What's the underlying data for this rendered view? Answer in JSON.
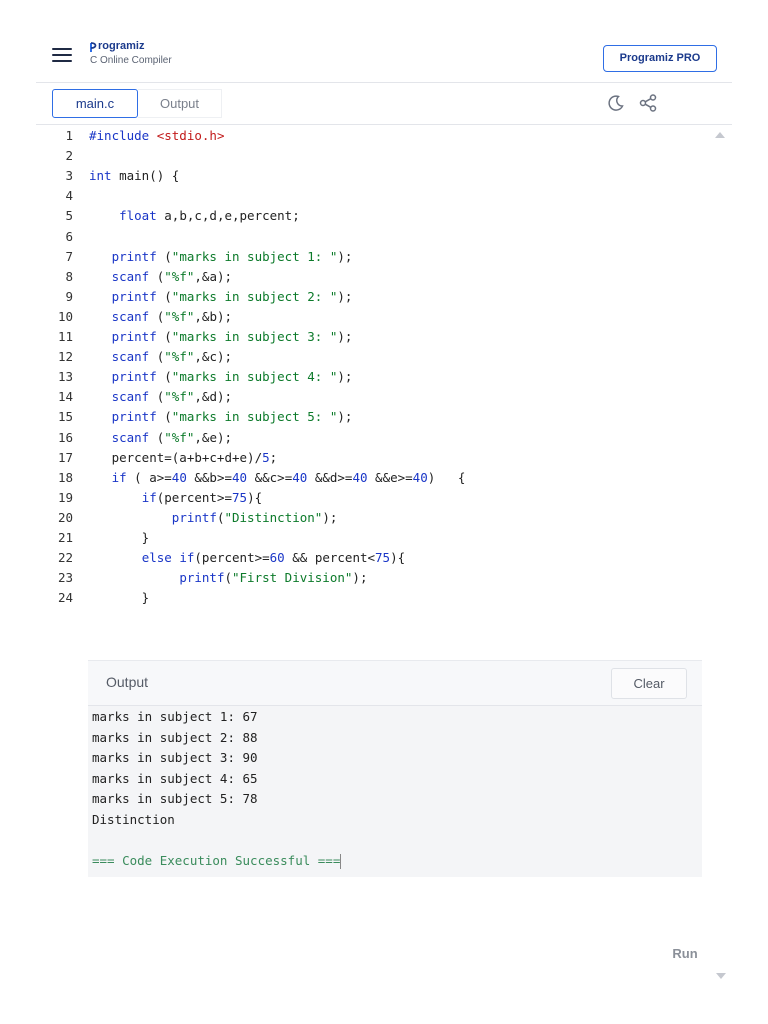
{
  "header": {
    "logo_text": "rogramiz",
    "logo_letter": "P",
    "subtitle": "C Online Compiler",
    "pro_button": "Programiz PRO"
  },
  "tabs": {
    "main": "main.c",
    "output": "Output"
  },
  "icons": {
    "menu": "hamburger-icon",
    "theme": "moon-icon",
    "share": "share-icon"
  },
  "editor": {
    "line_numbers": [
      "1",
      "2",
      "3",
      "4",
      "5",
      "6",
      "7",
      "8",
      "9",
      "10",
      "11",
      "12",
      "13",
      "14",
      "15",
      "16",
      "17",
      "18",
      "19",
      "20",
      "21",
      "22",
      "23",
      "24"
    ],
    "lines": [
      "#include <stdio.h>",
      "",
      "int main() {",
      "",
      "    float a,b,c,d,e,percent;",
      "",
      "   printf (\"marks in subject 1: \");",
      "   scanf (\"%f\",&a);",
      "   printf (\"marks in subject 2: \");",
      "   scanf (\"%f\",&b);",
      "   printf (\"marks in subject 3: \");",
      "   scanf (\"%f\",&c);",
      "   printf (\"marks in subject 4: \");",
      "   scanf (\"%f\",&d);",
      "   printf (\"marks in subject 5: \");",
      "   scanf (\"%f\",&e);",
      "   percent=(a+b+c+d+e)/5;",
      "   if ( a>=40 &&b>=40 &&c>=40 &&d>=40 &&e>=40)   {",
      "       if(percent>=75){",
      "           printf(\"Distinction\");",
      "       }",
      "       else if(percent>=60 && percent<75){",
      "            printf(\"First Division\");",
      "       }"
    ]
  },
  "output": {
    "title": "Output",
    "clear_button": "Clear",
    "lines": [
      "marks in subject 1: 67",
      "marks in subject 2: 88",
      "marks in subject 3: 90",
      "marks in subject 4: 65",
      "marks in subject 5: 78",
      "Distinction",
      "",
      "=== Code Execution Successful ==="
    ]
  },
  "run_button": "Run",
  "colors": {
    "accent": "#2f6ee5",
    "brand": "#1b3a8c",
    "keyword": "#1a36c7",
    "string": "#0c7a2a",
    "include": "#c21a1a",
    "success": "#3a8c5c"
  }
}
